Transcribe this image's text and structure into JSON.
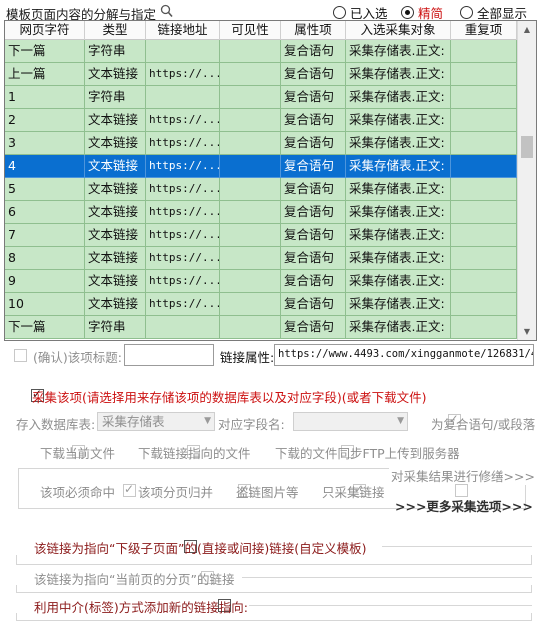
{
  "header": {
    "title": "模板页面内容的分解与指定",
    "radios": [
      {
        "label": "已入选",
        "selected": false
      },
      {
        "label": "精简",
        "selected": true
      },
      {
        "label": "全部显示",
        "selected": false
      }
    ]
  },
  "table": {
    "columns": [
      "网页字符",
      "类型",
      "链接地址",
      "可见性",
      "属性项",
      "入选采集对象",
      "重复项"
    ],
    "rows": [
      [
        "下一篇",
        "字符串",
        "",
        "",
        "复合语句",
        "采集存储表.正文:",
        ""
      ],
      [
        "上一篇",
        "文本链接",
        "https://...",
        "",
        "复合语句",
        "采集存储表.正文:",
        ""
      ],
      [
        "1",
        "字符串",
        "",
        "",
        "复合语句",
        "采集存储表.正文:",
        ""
      ],
      [
        "2",
        "文本链接",
        "https://...",
        "",
        "复合语句",
        "采集存储表.正文:",
        ""
      ],
      [
        "3",
        "文本链接",
        "https://...",
        "",
        "复合语句",
        "采集存储表.正文:",
        ""
      ],
      [
        "4",
        "文本链接",
        "https://...",
        "",
        "复合语句",
        "采集存储表.正文:",
        ""
      ],
      [
        "5",
        "文本链接",
        "https://...",
        "",
        "复合语句",
        "采集存储表.正文:",
        ""
      ],
      [
        "6",
        "文本链接",
        "https://...",
        "",
        "复合语句",
        "采集存储表.正文:",
        ""
      ],
      [
        "7",
        "文本链接",
        "https://...",
        "",
        "复合语句",
        "采集存储表.正文:",
        ""
      ],
      [
        "8",
        "文本链接",
        "https://...",
        "",
        "复合语句",
        "采集存储表.正文:",
        ""
      ],
      [
        "9",
        "文本链接",
        "https://...",
        "",
        "复合语句",
        "采集存储表.正文:",
        ""
      ],
      [
        "10",
        "文本链接",
        "https://...",
        "",
        "复合语句",
        "采集存储表.正文:",
        ""
      ],
      [
        "下一篇",
        "字符串",
        "",
        "",
        "复合语句",
        "采集存储表.正文:",
        ""
      ]
    ],
    "selected_row": 5,
    "scrollbar": {
      "up_icon": "▲",
      "down_icon": "▼"
    }
  },
  "confirm": {
    "label": "(确认)该项标题:",
    "title_value": "",
    "link_attr_label": "链接属性:",
    "link_attr_value": "https://www.4493.com/xingganmote/126831/4."
  },
  "collect": {
    "checkbox_label": "采集该项(请选择用来存储该项的数据库表以及对应字段)(或者下载文件)",
    "db_label": "存入数据库表:",
    "db_value": "采集存储表",
    "field_label": "对应字段名:",
    "field_value": "",
    "compound_label": "为复合语句/或段落",
    "download_current": "下载当前文件",
    "download_link": "下载链接指向的文件",
    "ftp_upload": "下载的文件同步FTP上传到服务器",
    "refine_link": "对采集结果进行修缮>>>",
    "must_hit": "该项必须命中",
    "merge_pages": "该项分页归并",
    "hotlink_images": "盗链图片等",
    "only_links": "只采集链接",
    "more_options": ">>>更多采集选项>>>"
  },
  "options": {
    "child_page_link": "该链接为指向“下级子页面”的(直接或间接)链接(自定义模板)",
    "current_page_pagination": "该链接为指向“当前页的分页”的链接",
    "intermediary_link": "利用中介(标签)方式添加新的链接指向:"
  },
  "colors": {
    "row_green": "#c7e7c7",
    "selected_blue": "#0a6fd0",
    "accent_red": "#cc1111"
  }
}
